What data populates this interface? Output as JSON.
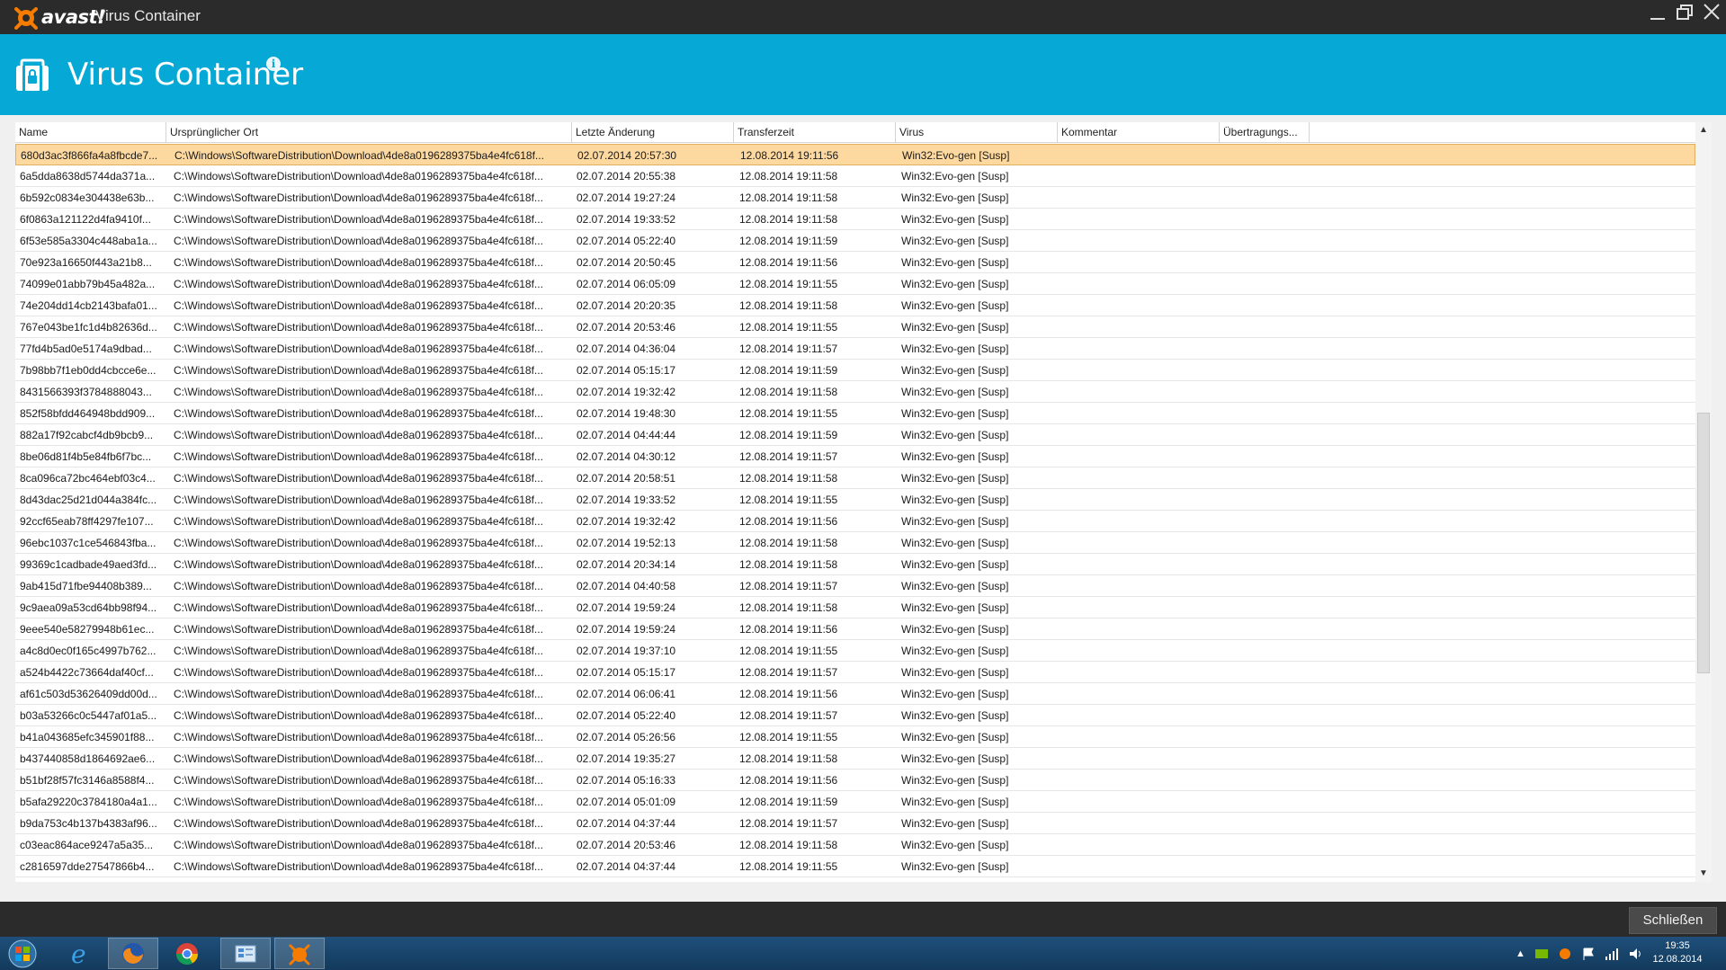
{
  "app": {
    "brand": "avast!",
    "window_title": "Virus Container",
    "header_title": "Virus Container"
  },
  "colors": {
    "header_bg": "#06a8d6",
    "titlebar_bg": "#2b2b2b",
    "selected_row": "#fdd9a0",
    "brand_orange": "#f57c00"
  },
  "columns": {
    "name": "Name",
    "path": "Ursprünglicher Ort",
    "date": "Letzte Änderung",
    "xfer": "Transferzeit",
    "virus": "Virus",
    "comment": "Kommentar",
    "upload": "Übertragungs..."
  },
  "rows": [
    {
      "name": "680d3ac3f866fa4a8fbcde7...",
      "path": "C:\\Windows\\SoftwareDistribution\\Download\\4de8a0196289375ba4e4fc618f...",
      "date": "02.07.2014 20:57:30",
      "xfer": "12.08.2014 19:11:56",
      "virus": "Win32:Evo-gen [Susp]"
    },
    {
      "name": "6a5dda8638d5744da371a...",
      "path": "C:\\Windows\\SoftwareDistribution\\Download\\4de8a0196289375ba4e4fc618f...",
      "date": "02.07.2014 20:55:38",
      "xfer": "12.08.2014 19:11:58",
      "virus": "Win32:Evo-gen [Susp]"
    },
    {
      "name": "6b592c0834e304438e63b...",
      "path": "C:\\Windows\\SoftwareDistribution\\Download\\4de8a0196289375ba4e4fc618f...",
      "date": "02.07.2014 19:27:24",
      "xfer": "12.08.2014 19:11:58",
      "virus": "Win32:Evo-gen [Susp]"
    },
    {
      "name": "6f0863a121122d4fa9410f...",
      "path": "C:\\Windows\\SoftwareDistribution\\Download\\4de8a0196289375ba4e4fc618f...",
      "date": "02.07.2014 19:33:52",
      "xfer": "12.08.2014 19:11:58",
      "virus": "Win32:Evo-gen [Susp]"
    },
    {
      "name": "6f53e585a3304c448aba1a...",
      "path": "C:\\Windows\\SoftwareDistribution\\Download\\4de8a0196289375ba4e4fc618f...",
      "date": "02.07.2014 05:22:40",
      "xfer": "12.08.2014 19:11:59",
      "virus": "Win32:Evo-gen [Susp]"
    },
    {
      "name": "70e923a16650f443a21b8...",
      "path": "C:\\Windows\\SoftwareDistribution\\Download\\4de8a0196289375ba4e4fc618f...",
      "date": "02.07.2014 20:50:45",
      "xfer": "12.08.2014 19:11:56",
      "virus": "Win32:Evo-gen [Susp]"
    },
    {
      "name": "74099e01abb79b45a482a...",
      "path": "C:\\Windows\\SoftwareDistribution\\Download\\4de8a0196289375ba4e4fc618f...",
      "date": "02.07.2014 06:05:09",
      "xfer": "12.08.2014 19:11:55",
      "virus": "Win32:Evo-gen [Susp]"
    },
    {
      "name": "74e204dd14cb2143bafa01...",
      "path": "C:\\Windows\\SoftwareDistribution\\Download\\4de8a0196289375ba4e4fc618f...",
      "date": "02.07.2014 20:20:35",
      "xfer": "12.08.2014 19:11:58",
      "virus": "Win32:Evo-gen [Susp]"
    },
    {
      "name": "767e043be1fc1d4b82636d...",
      "path": "C:\\Windows\\SoftwareDistribution\\Download\\4de8a0196289375ba4e4fc618f...",
      "date": "02.07.2014 20:53:46",
      "xfer": "12.08.2014 19:11:55",
      "virus": "Win32:Evo-gen [Susp]"
    },
    {
      "name": "77fd4b5ad0e5174a9dbad...",
      "path": "C:\\Windows\\SoftwareDistribution\\Download\\4de8a0196289375ba4e4fc618f...",
      "date": "02.07.2014 04:36:04",
      "xfer": "12.08.2014 19:11:57",
      "virus": "Win32:Evo-gen [Susp]"
    },
    {
      "name": "7b98bb7f1eb0dd4cbcce6e...",
      "path": "C:\\Windows\\SoftwareDistribution\\Download\\4de8a0196289375ba4e4fc618f...",
      "date": "02.07.2014 05:15:17",
      "xfer": "12.08.2014 19:11:59",
      "virus": "Win32:Evo-gen [Susp]"
    },
    {
      "name": "8431566393f3784888043...",
      "path": "C:\\Windows\\SoftwareDistribution\\Download\\4de8a0196289375ba4e4fc618f...",
      "date": "02.07.2014 19:32:42",
      "xfer": "12.08.2014 19:11:58",
      "virus": "Win32:Evo-gen [Susp]"
    },
    {
      "name": "852f58bfdd464948bdd909...",
      "path": "C:\\Windows\\SoftwareDistribution\\Download\\4de8a0196289375ba4e4fc618f...",
      "date": "02.07.2014 19:48:30",
      "xfer": "12.08.2014 19:11:55",
      "virus": "Win32:Evo-gen [Susp]"
    },
    {
      "name": "882a17f92cabcf4db9bcb9...",
      "path": "C:\\Windows\\SoftwareDistribution\\Download\\4de8a0196289375ba4e4fc618f...",
      "date": "02.07.2014 04:44:44",
      "xfer": "12.08.2014 19:11:59",
      "virus": "Win32:Evo-gen [Susp]"
    },
    {
      "name": "8be06d81f4b5e84fb6f7bc...",
      "path": "C:\\Windows\\SoftwareDistribution\\Download\\4de8a0196289375ba4e4fc618f...",
      "date": "02.07.2014 04:30:12",
      "xfer": "12.08.2014 19:11:57",
      "virus": "Win32:Evo-gen [Susp]"
    },
    {
      "name": "8ca096ca72bc464ebf03c4...",
      "path": "C:\\Windows\\SoftwareDistribution\\Download\\4de8a0196289375ba4e4fc618f...",
      "date": "02.07.2014 20:58:51",
      "xfer": "12.08.2014 19:11:58",
      "virus": "Win32:Evo-gen [Susp]"
    },
    {
      "name": "8d43dac25d21d044a384fc...",
      "path": "C:\\Windows\\SoftwareDistribution\\Download\\4de8a0196289375ba4e4fc618f...",
      "date": "02.07.2014 19:33:52",
      "xfer": "12.08.2014 19:11:55",
      "virus": "Win32:Evo-gen [Susp]"
    },
    {
      "name": "92ccf65eab78ff4297fe107...",
      "path": "C:\\Windows\\SoftwareDistribution\\Download\\4de8a0196289375ba4e4fc618f...",
      "date": "02.07.2014 19:32:42",
      "xfer": "12.08.2014 19:11:56",
      "virus": "Win32:Evo-gen [Susp]"
    },
    {
      "name": "96ebc1037c1ce546843fba...",
      "path": "C:\\Windows\\SoftwareDistribution\\Download\\4de8a0196289375ba4e4fc618f...",
      "date": "02.07.2014 19:52:13",
      "xfer": "12.08.2014 19:11:58",
      "virus": "Win32:Evo-gen [Susp]"
    },
    {
      "name": "99369c1cadbade49aed3fd...",
      "path": "C:\\Windows\\SoftwareDistribution\\Download\\4de8a0196289375ba4e4fc618f...",
      "date": "02.07.2014 20:34:14",
      "xfer": "12.08.2014 19:11:58",
      "virus": "Win32:Evo-gen [Susp]"
    },
    {
      "name": "9ab415d71fbe94408b389...",
      "path": "C:\\Windows\\SoftwareDistribution\\Download\\4de8a0196289375ba4e4fc618f...",
      "date": "02.07.2014 04:40:58",
      "xfer": "12.08.2014 19:11:57",
      "virus": "Win32:Evo-gen [Susp]"
    },
    {
      "name": "9c9aea09a53cd64bb98f94...",
      "path": "C:\\Windows\\SoftwareDistribution\\Download\\4de8a0196289375ba4e4fc618f...",
      "date": "02.07.2014 19:59:24",
      "xfer": "12.08.2014 19:11:58",
      "virus": "Win32:Evo-gen [Susp]"
    },
    {
      "name": "9eee540e58279948b61ec...",
      "path": "C:\\Windows\\SoftwareDistribution\\Download\\4de8a0196289375ba4e4fc618f...",
      "date": "02.07.2014 19:59:24",
      "xfer": "12.08.2014 19:11:56",
      "virus": "Win32:Evo-gen [Susp]"
    },
    {
      "name": "a4c8d0ec0f165c4997b762...",
      "path": "C:\\Windows\\SoftwareDistribution\\Download\\4de8a0196289375ba4e4fc618f...",
      "date": "02.07.2014 19:37:10",
      "xfer": "12.08.2014 19:11:55",
      "virus": "Win32:Evo-gen [Susp]"
    },
    {
      "name": "a524b4422c73664daf40cf...",
      "path": "C:\\Windows\\SoftwareDistribution\\Download\\4de8a0196289375ba4e4fc618f...",
      "date": "02.07.2014 05:15:17",
      "xfer": "12.08.2014 19:11:57",
      "virus": "Win32:Evo-gen [Susp]"
    },
    {
      "name": "af61c503d53626409dd00d...",
      "path": "C:\\Windows\\SoftwareDistribution\\Download\\4de8a0196289375ba4e4fc618f...",
      "date": "02.07.2014 06:06:41",
      "xfer": "12.08.2014 19:11:56",
      "virus": "Win32:Evo-gen [Susp]"
    },
    {
      "name": "b03a53266c0c5447af01a5...",
      "path": "C:\\Windows\\SoftwareDistribution\\Download\\4de8a0196289375ba4e4fc618f...",
      "date": "02.07.2014 05:22:40",
      "xfer": "12.08.2014 19:11:57",
      "virus": "Win32:Evo-gen [Susp]"
    },
    {
      "name": "b41a043685efc345901f88...",
      "path": "C:\\Windows\\SoftwareDistribution\\Download\\4de8a0196289375ba4e4fc618f...",
      "date": "02.07.2014 05:26:56",
      "xfer": "12.08.2014 19:11:55",
      "virus": "Win32:Evo-gen [Susp]"
    },
    {
      "name": "b437440858d1864692ae6...",
      "path": "C:\\Windows\\SoftwareDistribution\\Download\\4de8a0196289375ba4e4fc618f...",
      "date": "02.07.2014 19:35:27",
      "xfer": "12.08.2014 19:11:58",
      "virus": "Win32:Evo-gen [Susp]"
    },
    {
      "name": "b51bf28f57fc3146a8588f4...",
      "path": "C:\\Windows\\SoftwareDistribution\\Download\\4de8a0196289375ba4e4fc618f...",
      "date": "02.07.2014 05:16:33",
      "xfer": "12.08.2014 19:11:56",
      "virus": "Win32:Evo-gen [Susp]"
    },
    {
      "name": "b5afa29220c3784180a4a1...",
      "path": "C:\\Windows\\SoftwareDistribution\\Download\\4de8a0196289375ba4e4fc618f...",
      "date": "02.07.2014 05:01:09",
      "xfer": "12.08.2014 19:11:59",
      "virus": "Win32:Evo-gen [Susp]"
    },
    {
      "name": "b9da753c4b137b4383af96...",
      "path": "C:\\Windows\\SoftwareDistribution\\Download\\4de8a0196289375ba4e4fc618f...",
      "date": "02.07.2014 04:37:44",
      "xfer": "12.08.2014 19:11:57",
      "virus": "Win32:Evo-gen [Susp]"
    },
    {
      "name": "c03eac864ace9247a5a35...",
      "path": "C:\\Windows\\SoftwareDistribution\\Download\\4de8a0196289375ba4e4fc618f...",
      "date": "02.07.2014 20:53:46",
      "xfer": "12.08.2014 19:11:58",
      "virus": "Win32:Evo-gen [Susp]"
    },
    {
      "name": "c2816597dde27547866b4...",
      "path": "C:\\Windows\\SoftwareDistribution\\Download\\4de8a0196289375ba4e4fc618f...",
      "date": "02.07.2014 04:37:44",
      "xfer": "12.08.2014 19:11:55",
      "virus": "Win32:Evo-gen [Susp]"
    }
  ],
  "footer": {
    "close_label": "Schließen"
  },
  "clock": {
    "time": "19:35",
    "date": "12.08.2014"
  },
  "icons": {
    "logo": "avast-logo-icon",
    "header": "container-lock-icon",
    "info": "info-icon"
  }
}
